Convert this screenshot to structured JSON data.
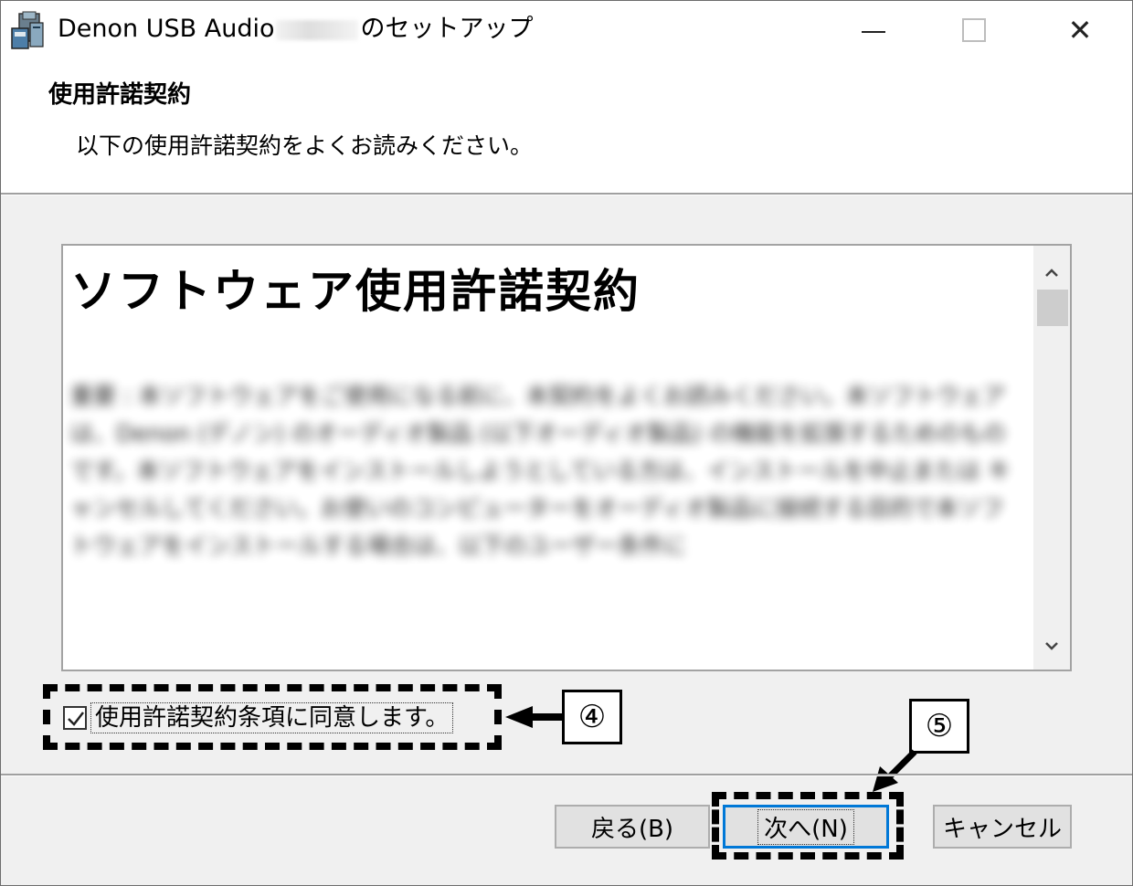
{
  "window": {
    "title_prefix": "Denon USB Audio",
    "title_suffix": "のセットアップ",
    "minimize_label": "",
    "close_label": "✕"
  },
  "header": {
    "title": "使用許諾契約",
    "subtitle": "以下の使用許諾契約をよくお読みください。"
  },
  "license": {
    "heading": "ソフトウェア使用許諾契約",
    "body": "重要 : 本ソフトウェアをご使用になる前に、本契約をよくお読みください。本ソフトウェアは、Denon (デノン) のオーディオ製品 (以下オーディオ製品) の機能を拡張するためのものです。本ソフトウェアをインストールしようとしている方は、インストールを中止または キャンセルしてください。お使いのコンピューターをオーディオ製品に接続する目的で本ソフトウェアをインストールする場合は、以下のユーザー条件に"
  },
  "agree": {
    "checked": true,
    "label": "使用許諾契約条項に同意します。"
  },
  "callouts": {
    "four": "④",
    "five": "⑤"
  },
  "buttons": {
    "back": "戻る(B)",
    "next": "次へ(N)",
    "cancel": "キャンセル"
  },
  "colors": {
    "primary_border": "#0078d7",
    "window_bg": "#f0f0f0"
  }
}
